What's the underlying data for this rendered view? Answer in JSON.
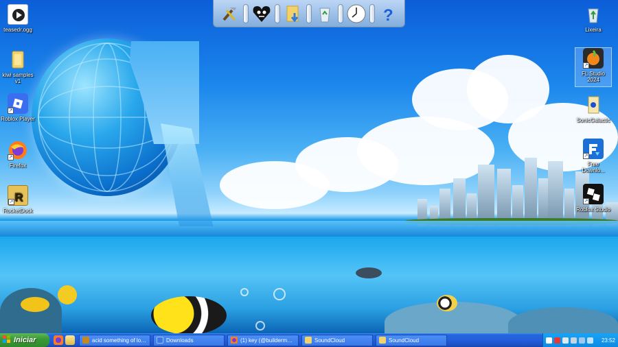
{
  "desktop_icons": [
    {
      "name": "teasedr-ogg",
      "label": "teasedr.ogg",
      "icon": "audio-file-icon"
    },
    {
      "name": "kiwi-samples",
      "label": "kiwi samples v1",
      "icon": "folder-icon"
    },
    {
      "name": "roblox-player",
      "label": "Roblox Player",
      "icon": "roblox-icon"
    },
    {
      "name": "firefox",
      "label": "Firefox",
      "icon": "firefox-icon"
    },
    {
      "name": "rocketdock",
      "label": "RocketDock",
      "icon": "rocketdock-icon"
    },
    {
      "name": "lixeira",
      "label": "Lixeira",
      "icon": "recycle-bin-icon"
    },
    {
      "name": "fl-studio",
      "label": "FL Studio 2024",
      "icon": "fl-studio-icon"
    },
    {
      "name": "sonicgalactic",
      "label": "SonicGalactic",
      "icon": "sonic-icon"
    },
    {
      "name": "free-download",
      "label": "Free Downlo...",
      "icon": "free-download-icon"
    },
    {
      "name": "roblox-studio",
      "label": "Roblox Studio",
      "icon": "roblox-studio-icon"
    }
  ],
  "dock": {
    "items": [
      "tools-icon",
      "heart-skull-icon",
      "folder-download-icon",
      "recycle-bin-icon",
      "clock-icon",
      "help-icon"
    ]
  },
  "taskbar": {
    "start_label": "Iniciar",
    "quick_launch": [
      "firefox-icon",
      "explorer-icon"
    ],
    "tasks": [
      {
        "label": "acid something of love ...",
        "icon": "media-icon",
        "active": false
      },
      {
        "label": "Downloads",
        "icon": "folder-icon",
        "active": false
      },
      {
        "label": "(1) key (@buildermany...",
        "icon": "firefox-icon",
        "active": false
      },
      {
        "label": "SoundCloud",
        "icon": "folder-icon",
        "active": false
      },
      {
        "label": "SoundCloud",
        "icon": "folder-icon",
        "active": false
      }
    ],
    "clock": "23:52"
  }
}
